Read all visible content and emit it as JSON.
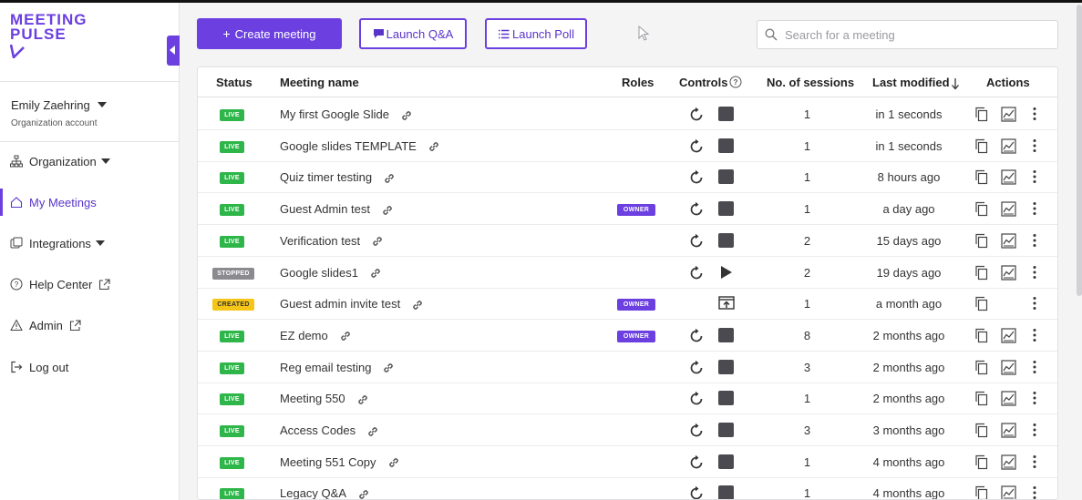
{
  "brand": {
    "line1": "MEETING",
    "line2": "PULSE",
    "mark": "V"
  },
  "user": {
    "name": "Emily Zaehring",
    "account_type": "Organization account"
  },
  "nav": [
    {
      "label": "Organization",
      "icon": "org-chart-icon",
      "has_caret": true,
      "active": false
    },
    {
      "label": "My Meetings",
      "icon": "home-icon",
      "has_caret": false,
      "active": true
    },
    {
      "label": "Integrations",
      "icon": "integrations-icon",
      "has_caret": true,
      "active": false
    },
    {
      "label": "Help Center",
      "icon": "help-icon",
      "external": true,
      "active": false
    },
    {
      "label": "Admin",
      "icon": "warning-icon",
      "external": true,
      "active": false
    },
    {
      "label": "Log out",
      "icon": "logout-icon",
      "active": false
    }
  ],
  "toolbar": {
    "create_label": "Create meeting",
    "qa_label": "Launch Q&A",
    "poll_label": "Launch Poll",
    "search_placeholder": "Search for a meeting"
  },
  "table": {
    "headers": {
      "status": "Status",
      "name": "Meeting name",
      "roles": "Roles",
      "controls": "Controls",
      "sessions": "No. of sessions",
      "modified": "Last modified",
      "actions": "Actions"
    },
    "rows": [
      {
        "status": "LIVE",
        "name": "My first Google Slide",
        "role": "",
        "control": "stop",
        "sessions": "1",
        "modified": "in 1 seconds",
        "has_chart": true
      },
      {
        "status": "LIVE",
        "name": "Google slides TEMPLATE",
        "role": "",
        "control": "stop",
        "sessions": "1",
        "modified": "in 1 seconds",
        "has_chart": true
      },
      {
        "status": "LIVE",
        "name": "Quiz timer testing",
        "role": "",
        "control": "stop",
        "sessions": "1",
        "modified": "8 hours ago",
        "has_chart": true
      },
      {
        "status": "LIVE",
        "name": "Guest Admin test",
        "role": "OWNER",
        "control": "stop",
        "sessions": "1",
        "modified": "a day ago",
        "has_chart": true
      },
      {
        "status": "LIVE",
        "name": "Verification test",
        "role": "",
        "control": "stop",
        "sessions": "2",
        "modified": "15 days ago",
        "has_chart": true
      },
      {
        "status": "STOPPED",
        "name": "Google slides1",
        "role": "",
        "control": "play",
        "sessions": "2",
        "modified": "19 days ago",
        "has_chart": true
      },
      {
        "status": "CREATED",
        "name": "Guest admin invite test",
        "role": "OWNER",
        "control": "present",
        "sessions": "1",
        "modified": "a month ago",
        "has_chart": false
      },
      {
        "status": "LIVE",
        "name": "EZ demo",
        "role": "OWNER",
        "control": "stop",
        "sessions": "8",
        "modified": "2 months ago",
        "has_chart": true
      },
      {
        "status": "LIVE",
        "name": "Reg email testing",
        "role": "",
        "control": "stop",
        "sessions": "3",
        "modified": "2 months ago",
        "has_chart": true
      },
      {
        "status": "LIVE",
        "name": "Meeting 550",
        "role": "",
        "control": "stop",
        "sessions": "1",
        "modified": "2 months ago",
        "has_chart": true
      },
      {
        "status": "LIVE",
        "name": "Access Codes",
        "role": "",
        "control": "stop",
        "sessions": "3",
        "modified": "3 months ago",
        "has_chart": true
      },
      {
        "status": "LIVE",
        "name": "Meeting 551 Copy",
        "role": "",
        "control": "stop",
        "sessions": "1",
        "modified": "4 months ago",
        "has_chart": true
      },
      {
        "status": "LIVE",
        "name": "Legacy Q&A",
        "role": "",
        "control": "stop",
        "sessions": "1",
        "modified": "4 months ago",
        "has_chart": true
      }
    ]
  },
  "colors": {
    "brand": "#6b3fe0",
    "live": "#2fb64a",
    "stopped": "#8a8a8f",
    "created": "#f5c518"
  }
}
